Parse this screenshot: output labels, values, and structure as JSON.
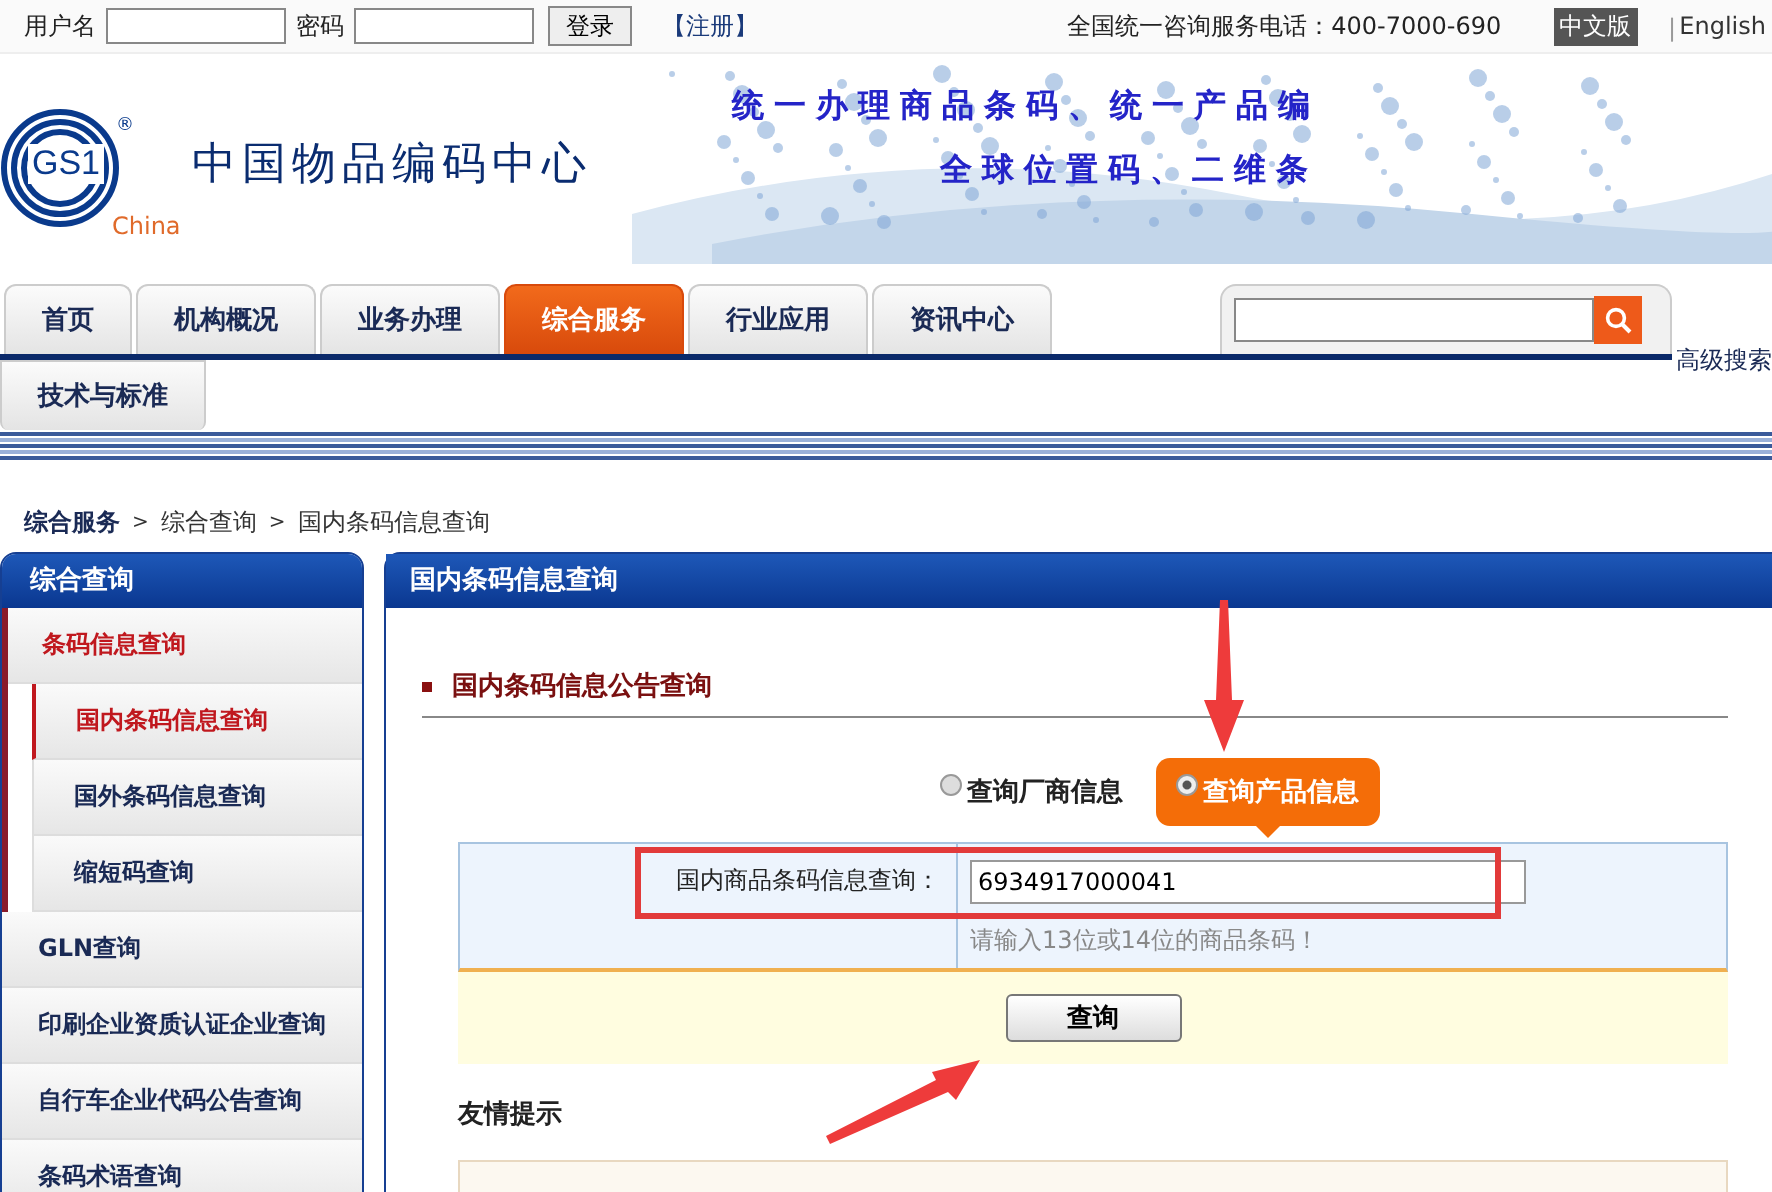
{
  "top_bar": {
    "username_label": "用户名",
    "password_label": "密码",
    "login_button": "登录",
    "register_link": "【注册】",
    "hotline": "全国统一咨询服务电话：400-7000-690",
    "languages": [
      {
        "label": "中文版",
        "selected": true
      },
      {
        "label": "English",
        "selected": false
      }
    ],
    "language_separator": "|"
  },
  "header": {
    "logo": {
      "mark": "GS1",
      "registered": "®",
      "region": "China"
    },
    "org_name": "中国物品编码中心",
    "slogan_lines": [
      "统一办理商品条码、统一产品编",
      "全球位置码、二维条"
    ]
  },
  "nav": {
    "tabs": [
      {
        "label": "首页",
        "selected": false
      },
      {
        "label": "机构概况",
        "selected": false
      },
      {
        "label": "业务办理",
        "selected": false
      },
      {
        "label": "综合服务",
        "selected": true
      },
      {
        "label": "行业应用",
        "selected": false
      },
      {
        "label": "资讯中心",
        "selected": false
      },
      {
        "label": "技术与标准",
        "selected": false
      }
    ],
    "advanced_search": "高级搜索"
  },
  "breadcrumb": {
    "items": [
      "综合服务",
      "综合查询",
      "国内条码信息查询"
    ],
    "separators": [
      ">",
      ">"
    ]
  },
  "sidebar": {
    "title": "综合查询",
    "items": [
      {
        "label": "条码信息查询",
        "expanded": true,
        "children": [
          {
            "label": "国内条码信息查询",
            "selected": true
          },
          {
            "label": "国外条码信息查询",
            "selected": false
          },
          {
            "label": "缩短码查询",
            "selected": false
          }
        ]
      },
      {
        "label": "GLN查询",
        "expanded": false
      },
      {
        "label": "印刷企业资质认证企业查询",
        "expanded": false
      },
      {
        "label": "自行车企业代码公告查询",
        "expanded": false
      },
      {
        "label": "条码术语查询",
        "expanded": false
      }
    ]
  },
  "main": {
    "title": "国内条码信息查询",
    "section_title": "国内条码信息公告查询",
    "query_types": [
      {
        "label": "查询厂商信息",
        "selected": false
      },
      {
        "label": "查询产品信息",
        "selected": true
      }
    ],
    "field": {
      "label": "国内商品条码信息查询：",
      "value": "6934917000041",
      "hint": "请输入13位或14位的商品条码！"
    },
    "submit_button": "查询",
    "tips_title": "友情提示"
  }
}
